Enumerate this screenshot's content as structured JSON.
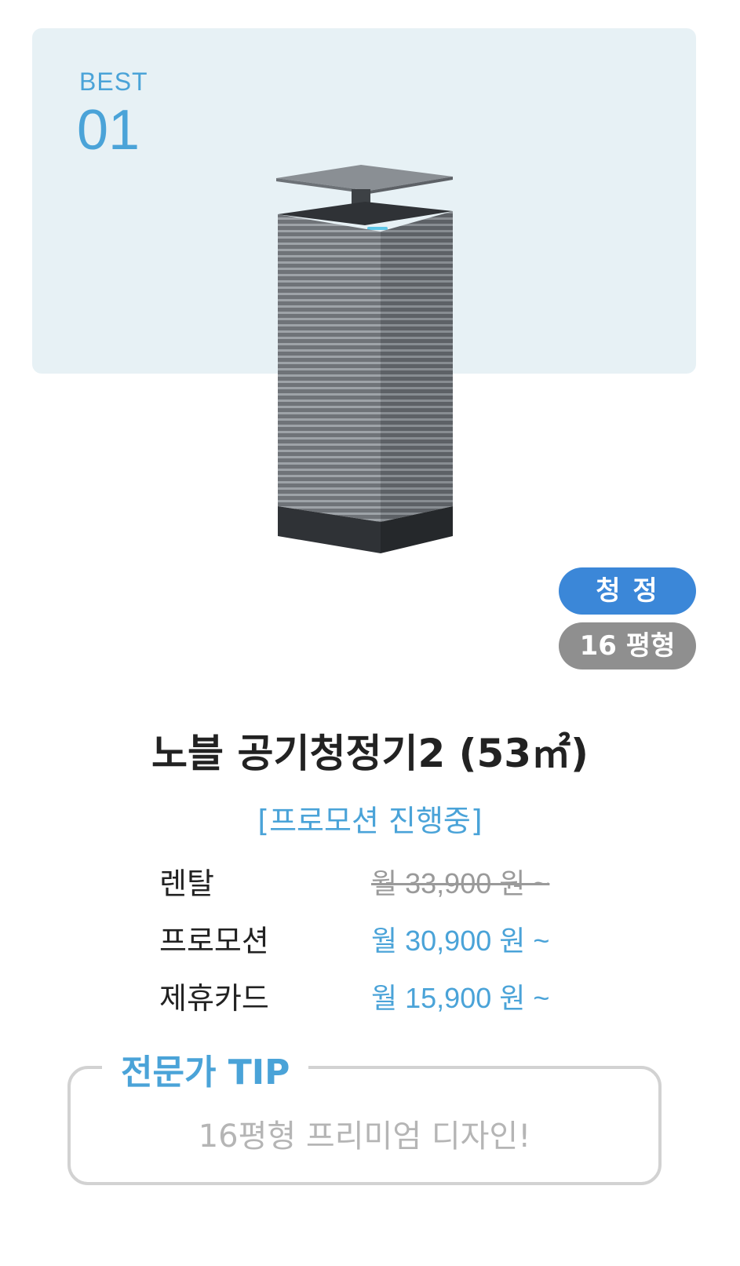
{
  "card": {
    "best_label": "BEST",
    "best_number": "01",
    "badges": {
      "category": "청 정",
      "size": "16 평형"
    },
    "title": "노블 공기청정기2 (53㎡)",
    "promo_tag": "[프로모션 진행중]",
    "prices": [
      {
        "label": "렌탈",
        "value": "월 33,900 원 ~",
        "struck": true
      },
      {
        "label": "프로모션",
        "value": "월 30,900 원 ~",
        "struck": false
      },
      {
        "label": "제휴카드",
        "value": "월 15,900 원 ~",
        "struck": false
      }
    ],
    "tip": {
      "title": "전문가 TIP",
      "text": "16평형 프리미엄 디자인!"
    }
  },
  "colors": {
    "accent": "#4aa3d8",
    "badge_blue": "#3b87d8",
    "badge_gray": "#8f8f8f",
    "hero_bg": "#e7f1f5"
  },
  "image": {
    "icon": "air-purifier-product-image"
  }
}
